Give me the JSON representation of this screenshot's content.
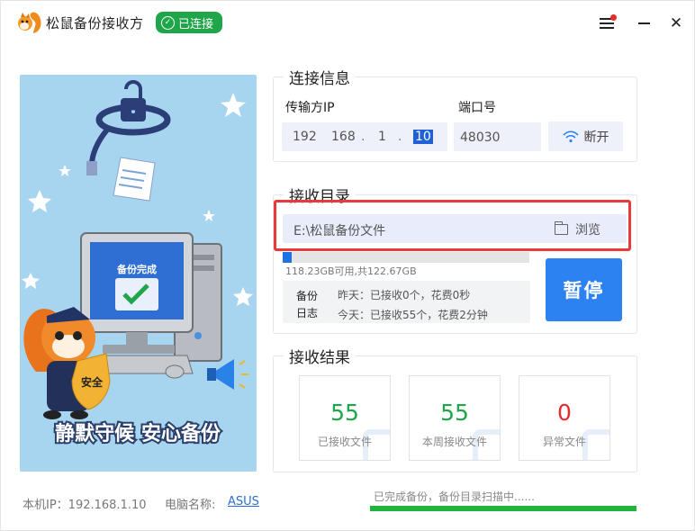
{
  "app": {
    "title": "松鼠备份接收方",
    "status_badge": "已连接",
    "badge_color": "#1fa64a"
  },
  "hero": {
    "screen_text": "备份完成",
    "shield_text": "安全",
    "slogan": "静默守候 安心备份"
  },
  "connection": {
    "title": "连接信息",
    "ip_label": "传输方IP",
    "ip": [
      "192",
      "168",
      "1",
      "10"
    ],
    "port_label": "端口号",
    "port": "48030",
    "disconnect_label": "断开"
  },
  "receive_dir": {
    "title": "接收目录",
    "path": "E:\\松鼠备份文件",
    "browse_label": "浏览",
    "disk_used_fraction": 0.036,
    "disk_text": "118.23GB可用,共122.67GB",
    "stats_label": "备份日志",
    "stats_label_top": "备份",
    "stats_label_bottom": "日志",
    "yesterday": "昨天：已接收0个，花费0秒",
    "today": "今天：已接收55个，花费2分钟",
    "pause_label": "暂停",
    "accent_color": "#2d82f2"
  },
  "results": {
    "title": "接收结果",
    "tiles": [
      {
        "value": "55",
        "label": "已接收文件",
        "color": "#1fa64a"
      },
      {
        "value": "55",
        "label": "本周接收文件",
        "color": "#1fa64a"
      },
      {
        "value": "0",
        "label": "异常文件",
        "color": "#e52b2b"
      }
    ]
  },
  "footer": {
    "local_ip": "本机IP：192.168.1.10",
    "pc_name_label": "电脑名称:",
    "pc_name": "ASUS",
    "scan_status": "已完成备份，备份目录扫描中......",
    "scan_progress": 1.0
  },
  "icons": {
    "logo": "squirrel-logo-icon",
    "badge": "check-circle-icon",
    "menu": "hamburger-menu-icon",
    "minimize": "minimize-icon",
    "close": "close-icon",
    "wifi": "wifi-icon",
    "folder": "folder-icon"
  }
}
